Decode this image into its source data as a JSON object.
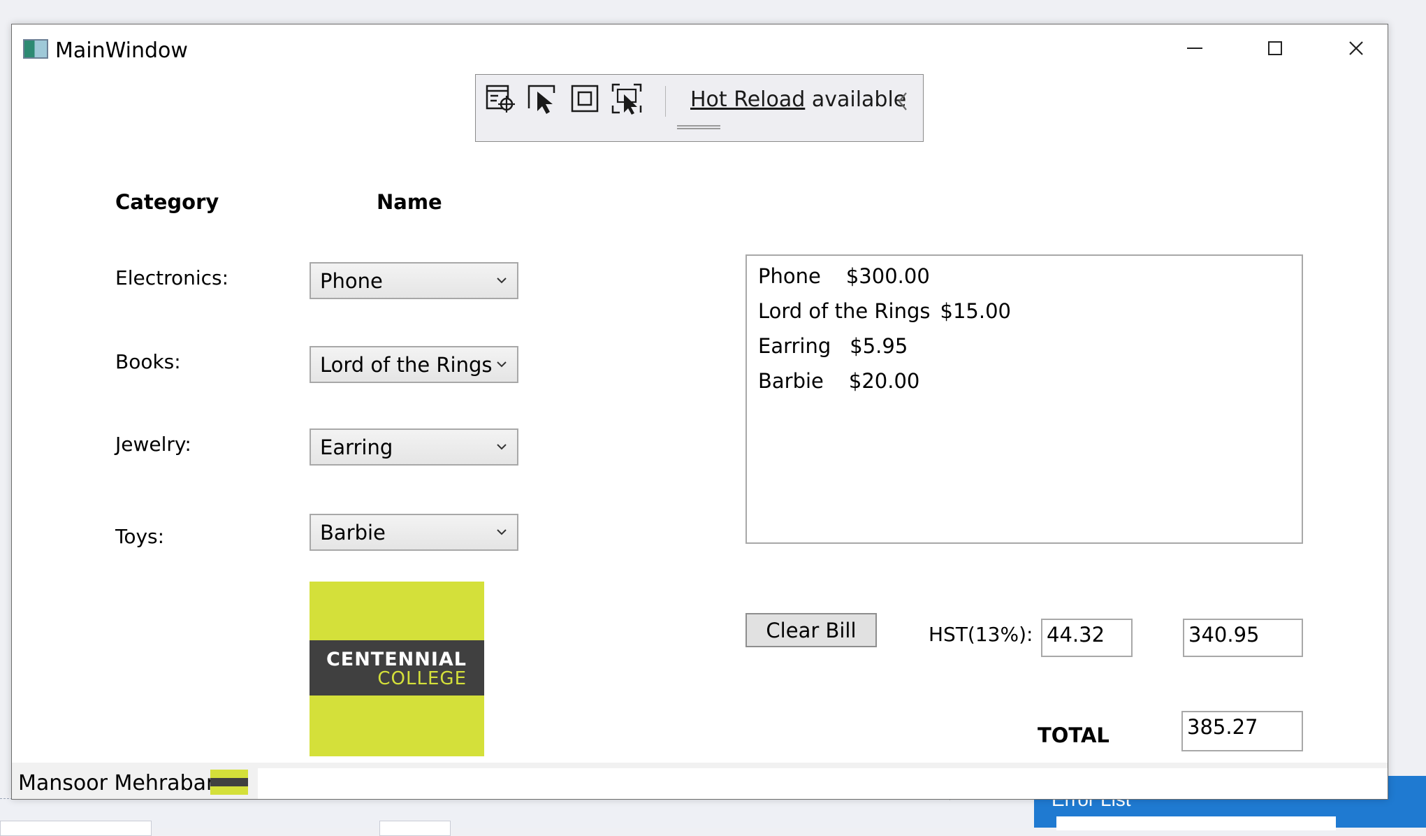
{
  "window": {
    "title": "MainWindow"
  },
  "hot_reload": {
    "link_text": "Hot Reload",
    "status_text": " available"
  },
  "headers": {
    "category": "Category",
    "name": "Name"
  },
  "categories": [
    {
      "label": "Electronics:",
      "selected": "Phone"
    },
    {
      "label": "Books:",
      "selected": "Lord of the Rings"
    },
    {
      "label": "Jewelry:",
      "selected": "Earring"
    },
    {
      "label": "Toys:",
      "selected": "Barbie"
    }
  ],
  "logo": {
    "line1": "CENTENNIAL",
    "line2": "COLLEGE"
  },
  "bill": {
    "items": [
      {
        "name": "Phone",
        "price": "$300.00"
      },
      {
        "name": "Lord of the Rings",
        "price": "$15.00"
      },
      {
        "name": "Earring",
        "price": "$5.95"
      },
      {
        "name": "Barbie",
        "price": "$20.00"
      }
    ]
  },
  "actions": {
    "clear_bill": "Clear Bill"
  },
  "totals": {
    "hst_label": "HST(13%):",
    "hst_value": "44.32",
    "subtotal_value": "340.95",
    "total_label": "TOTAL",
    "total_value": "385.27"
  },
  "footer": {
    "author": "Mansoor Mehraban"
  },
  "background": {
    "error_list_title": "Error List"
  },
  "colors": {
    "logo_green": "#d4e03a",
    "logo_dark": "#404040",
    "vs_blue": "#1f7ad1"
  }
}
